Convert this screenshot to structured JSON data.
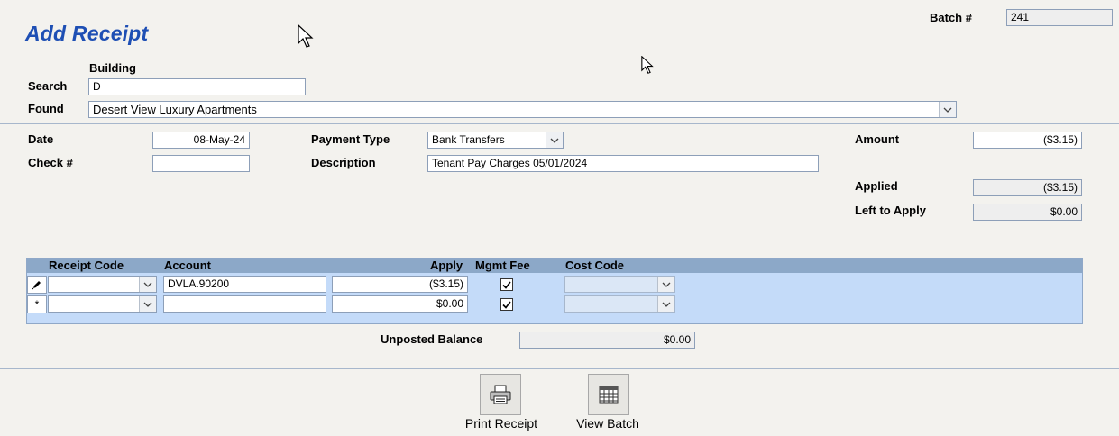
{
  "header": {
    "title": "Add Receipt",
    "batch_label": "Batch #",
    "batch_value": "241"
  },
  "search": {
    "building_label": "Building",
    "search_label": "Search",
    "search_value": "D",
    "found_label": "Found",
    "found_value": "Desert View Luxury Apartments"
  },
  "receipt": {
    "date_label": "Date",
    "date_value": "08-May-24",
    "check_label": "Check #",
    "check_value": "",
    "payment_type_label": "Payment Type",
    "payment_type_value": "Bank Transfers",
    "description_label": "Description",
    "description_value": "Tenant Pay Charges 05/01/2024",
    "amount_label": "Amount",
    "amount_value": "($3.15)",
    "applied_label": "Applied",
    "applied_value": "($3.15)",
    "left_label": "Left to Apply",
    "left_value": "$0.00"
  },
  "grid": {
    "headers": {
      "receipt_code": "Receipt Code",
      "account": "Account",
      "apply": "Apply",
      "mgmt_fee": "Mgmt Fee",
      "cost_code": "Cost Code"
    },
    "rows": [
      {
        "selector": "✎",
        "receipt_code": "",
        "account": "DVLA.90200",
        "apply": "($3.15)",
        "mgmt_fee": true,
        "cost_code": ""
      },
      {
        "selector": "*",
        "receipt_code": "",
        "account": "",
        "apply": "$0.00",
        "mgmt_fee": true,
        "cost_code": ""
      }
    ]
  },
  "unposted": {
    "label": "Unposted Balance",
    "value": "$0.00"
  },
  "buttons": {
    "print_label": "Print Receipt",
    "view_label": "View Batch"
  },
  "colors": {
    "title": "#1e4fb4",
    "grid_bg": "#c4dbf9",
    "grid_header": "#8ca8c8"
  },
  "icons": {
    "print": "printer-icon",
    "view": "table-icon",
    "dropdown": "chevron-down-icon",
    "check": "checkmark-icon",
    "cursor": "mouse-pointer-icon"
  }
}
